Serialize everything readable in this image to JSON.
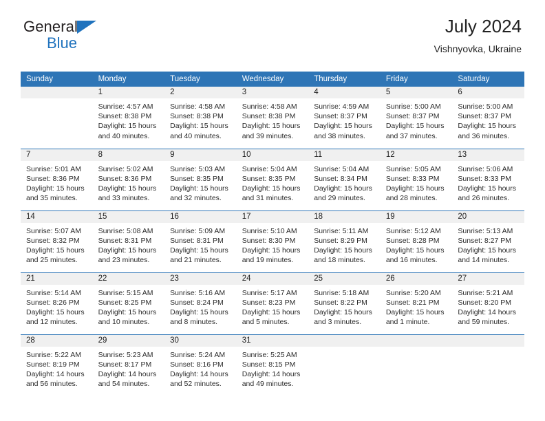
{
  "brand": {
    "name_part1": "General",
    "name_part2": "Blue",
    "flag_icon": "triangle-flag-icon",
    "accent_color": "#1f72bd"
  },
  "header": {
    "month_title": "July 2024",
    "location": "Vishnyovka, Ukraine"
  },
  "theme": {
    "header_blue": "#2e75b6",
    "daynum_gray": "#f0f0f0",
    "text": "#222222"
  },
  "calendar": {
    "weekday_headers": [
      "Sunday",
      "Monday",
      "Tuesday",
      "Wednesday",
      "Thursday",
      "Friday",
      "Saturday"
    ],
    "labels": {
      "sunrise": "Sunrise:",
      "sunset": "Sunset:",
      "daylight": "Daylight:"
    },
    "weeks": [
      [
        {
          "day": "",
          "sunrise": "",
          "sunset": "",
          "daylight_line1": "",
          "daylight_line2": ""
        },
        {
          "day": "1",
          "sunrise": "Sunrise: 4:57 AM",
          "sunset": "Sunset: 8:38 PM",
          "daylight_line1": "Daylight: 15 hours",
          "daylight_line2": "and 40 minutes."
        },
        {
          "day": "2",
          "sunrise": "Sunrise: 4:58 AM",
          "sunset": "Sunset: 8:38 PM",
          "daylight_line1": "Daylight: 15 hours",
          "daylight_line2": "and 40 minutes."
        },
        {
          "day": "3",
          "sunrise": "Sunrise: 4:58 AM",
          "sunset": "Sunset: 8:38 PM",
          "daylight_line1": "Daylight: 15 hours",
          "daylight_line2": "and 39 minutes."
        },
        {
          "day": "4",
          "sunrise": "Sunrise: 4:59 AM",
          "sunset": "Sunset: 8:37 PM",
          "daylight_line1": "Daylight: 15 hours",
          "daylight_line2": "and 38 minutes."
        },
        {
          "day": "5",
          "sunrise": "Sunrise: 5:00 AM",
          "sunset": "Sunset: 8:37 PM",
          "daylight_line1": "Daylight: 15 hours",
          "daylight_line2": "and 37 minutes."
        },
        {
          "day": "6",
          "sunrise": "Sunrise: 5:00 AM",
          "sunset": "Sunset: 8:37 PM",
          "daylight_line1": "Daylight: 15 hours",
          "daylight_line2": "and 36 minutes."
        }
      ],
      [
        {
          "day": "7",
          "sunrise": "Sunrise: 5:01 AM",
          "sunset": "Sunset: 8:36 PM",
          "daylight_line1": "Daylight: 15 hours",
          "daylight_line2": "and 35 minutes."
        },
        {
          "day": "8",
          "sunrise": "Sunrise: 5:02 AM",
          "sunset": "Sunset: 8:36 PM",
          "daylight_line1": "Daylight: 15 hours",
          "daylight_line2": "and 33 minutes."
        },
        {
          "day": "9",
          "sunrise": "Sunrise: 5:03 AM",
          "sunset": "Sunset: 8:35 PM",
          "daylight_line1": "Daylight: 15 hours",
          "daylight_line2": "and 32 minutes."
        },
        {
          "day": "10",
          "sunrise": "Sunrise: 5:04 AM",
          "sunset": "Sunset: 8:35 PM",
          "daylight_line1": "Daylight: 15 hours",
          "daylight_line2": "and 31 minutes."
        },
        {
          "day": "11",
          "sunrise": "Sunrise: 5:04 AM",
          "sunset": "Sunset: 8:34 PM",
          "daylight_line1": "Daylight: 15 hours",
          "daylight_line2": "and 29 minutes."
        },
        {
          "day": "12",
          "sunrise": "Sunrise: 5:05 AM",
          "sunset": "Sunset: 8:33 PM",
          "daylight_line1": "Daylight: 15 hours",
          "daylight_line2": "and 28 minutes."
        },
        {
          "day": "13",
          "sunrise": "Sunrise: 5:06 AM",
          "sunset": "Sunset: 8:33 PM",
          "daylight_line1": "Daylight: 15 hours",
          "daylight_line2": "and 26 minutes."
        }
      ],
      [
        {
          "day": "14",
          "sunrise": "Sunrise: 5:07 AM",
          "sunset": "Sunset: 8:32 PM",
          "daylight_line1": "Daylight: 15 hours",
          "daylight_line2": "and 25 minutes."
        },
        {
          "day": "15",
          "sunrise": "Sunrise: 5:08 AM",
          "sunset": "Sunset: 8:31 PM",
          "daylight_line1": "Daylight: 15 hours",
          "daylight_line2": "and 23 minutes."
        },
        {
          "day": "16",
          "sunrise": "Sunrise: 5:09 AM",
          "sunset": "Sunset: 8:31 PM",
          "daylight_line1": "Daylight: 15 hours",
          "daylight_line2": "and 21 minutes."
        },
        {
          "day": "17",
          "sunrise": "Sunrise: 5:10 AM",
          "sunset": "Sunset: 8:30 PM",
          "daylight_line1": "Daylight: 15 hours",
          "daylight_line2": "and 19 minutes."
        },
        {
          "day": "18",
          "sunrise": "Sunrise: 5:11 AM",
          "sunset": "Sunset: 8:29 PM",
          "daylight_line1": "Daylight: 15 hours",
          "daylight_line2": "and 18 minutes."
        },
        {
          "day": "19",
          "sunrise": "Sunrise: 5:12 AM",
          "sunset": "Sunset: 8:28 PM",
          "daylight_line1": "Daylight: 15 hours",
          "daylight_line2": "and 16 minutes."
        },
        {
          "day": "20",
          "sunrise": "Sunrise: 5:13 AM",
          "sunset": "Sunset: 8:27 PM",
          "daylight_line1": "Daylight: 15 hours",
          "daylight_line2": "and 14 minutes."
        }
      ],
      [
        {
          "day": "21",
          "sunrise": "Sunrise: 5:14 AM",
          "sunset": "Sunset: 8:26 PM",
          "daylight_line1": "Daylight: 15 hours",
          "daylight_line2": "and 12 minutes."
        },
        {
          "day": "22",
          "sunrise": "Sunrise: 5:15 AM",
          "sunset": "Sunset: 8:25 PM",
          "daylight_line1": "Daylight: 15 hours",
          "daylight_line2": "and 10 minutes."
        },
        {
          "day": "23",
          "sunrise": "Sunrise: 5:16 AM",
          "sunset": "Sunset: 8:24 PM",
          "daylight_line1": "Daylight: 15 hours",
          "daylight_line2": "and 8 minutes."
        },
        {
          "day": "24",
          "sunrise": "Sunrise: 5:17 AM",
          "sunset": "Sunset: 8:23 PM",
          "daylight_line1": "Daylight: 15 hours",
          "daylight_line2": "and 5 minutes."
        },
        {
          "day": "25",
          "sunrise": "Sunrise: 5:18 AM",
          "sunset": "Sunset: 8:22 PM",
          "daylight_line1": "Daylight: 15 hours",
          "daylight_line2": "and 3 minutes."
        },
        {
          "day": "26",
          "sunrise": "Sunrise: 5:20 AM",
          "sunset": "Sunset: 8:21 PM",
          "daylight_line1": "Daylight: 15 hours",
          "daylight_line2": "and 1 minute."
        },
        {
          "day": "27",
          "sunrise": "Sunrise: 5:21 AM",
          "sunset": "Sunset: 8:20 PM",
          "daylight_line1": "Daylight: 14 hours",
          "daylight_line2": "and 59 minutes."
        }
      ],
      [
        {
          "day": "28",
          "sunrise": "Sunrise: 5:22 AM",
          "sunset": "Sunset: 8:19 PM",
          "daylight_line1": "Daylight: 14 hours",
          "daylight_line2": "and 56 minutes."
        },
        {
          "day": "29",
          "sunrise": "Sunrise: 5:23 AM",
          "sunset": "Sunset: 8:17 PM",
          "daylight_line1": "Daylight: 14 hours",
          "daylight_line2": "and 54 minutes."
        },
        {
          "day": "30",
          "sunrise": "Sunrise: 5:24 AM",
          "sunset": "Sunset: 8:16 PM",
          "daylight_line1": "Daylight: 14 hours",
          "daylight_line2": "and 52 minutes."
        },
        {
          "day": "31",
          "sunrise": "Sunrise: 5:25 AM",
          "sunset": "Sunset: 8:15 PM",
          "daylight_line1": "Daylight: 14 hours",
          "daylight_line2": "and 49 minutes."
        },
        {
          "day": "",
          "sunrise": "",
          "sunset": "",
          "daylight_line1": "",
          "daylight_line2": ""
        },
        {
          "day": "",
          "sunrise": "",
          "sunset": "",
          "daylight_line1": "",
          "daylight_line2": ""
        },
        {
          "day": "",
          "sunrise": "",
          "sunset": "",
          "daylight_line1": "",
          "daylight_line2": ""
        }
      ]
    ]
  }
}
